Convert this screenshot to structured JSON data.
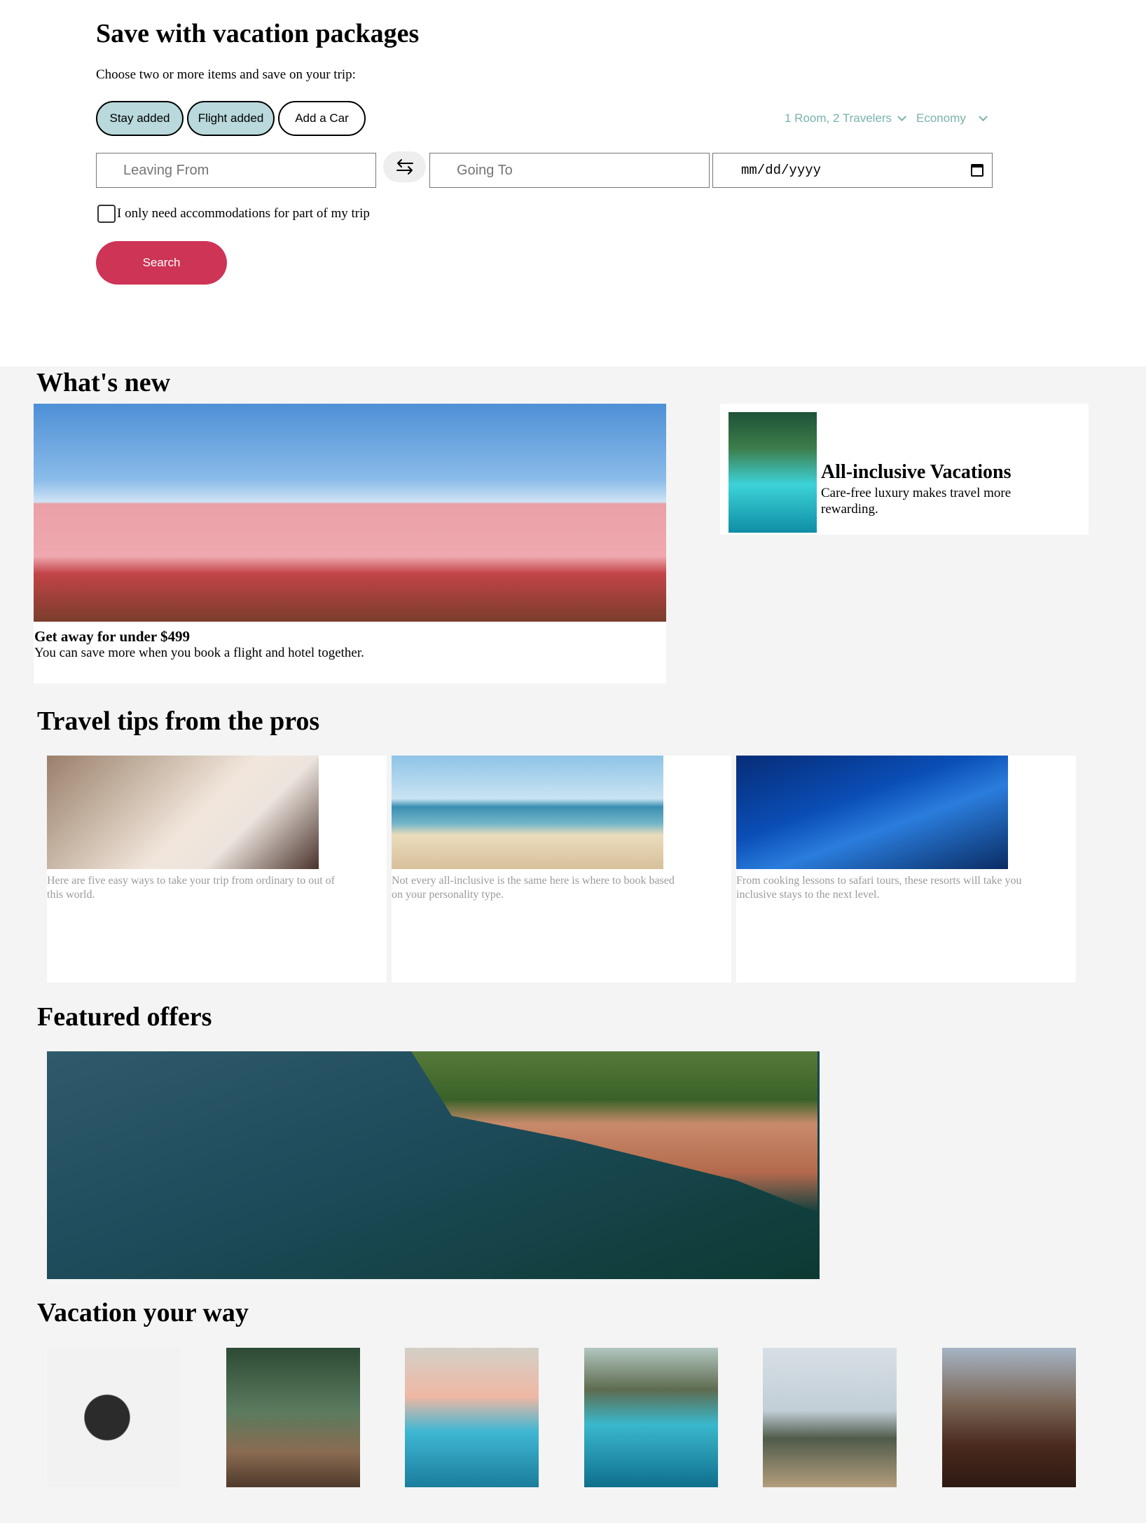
{
  "search": {
    "title": "Save with vacation packages",
    "subtitle": "Choose two or more items and save on your trip:",
    "pills": {
      "stay": "Stay added",
      "flight": "Flight added",
      "car": "Add a Car"
    },
    "travelers": "1 Room, 2 Travelers",
    "cabin_class": "Economy",
    "leaving_from_placeholder": "Leaving From",
    "going_to_placeholder": "Going To",
    "date_placeholder": "mm/dd/yyyy",
    "partial_stay_label": "I only need accommodations for part of my trip",
    "search_button": "Search"
  },
  "whats_new": {
    "title": "What's new",
    "main_card": {
      "title": "Get away for under $499",
      "text": "You can save more when you book a flight and hotel together."
    },
    "side_card": {
      "title": "All-inclusive Vacations",
      "text": "Care-free luxury makes travel more rewarding."
    }
  },
  "travel_tips": {
    "title": "Travel tips from the pros",
    "cards": [
      {
        "text": "Here are five easy ways to take your trip from ordinary to out of this world."
      },
      {
        "text": "Not every all-inclusive is the same here is where to book based on your personality type."
      },
      {
        "text": "From cooking lessons to safari tours, these resorts will take you inclusive stays to the next level."
      }
    ]
  },
  "featured": {
    "title": "Featured offers"
  },
  "vacation_your_way": {
    "title": "Vacation your way"
  },
  "colors": {
    "accent": "#cd3456",
    "pill_added": "#b9d9dc",
    "dropdown_text": "#79b2ad",
    "content_bg": "#f4f4f4"
  }
}
